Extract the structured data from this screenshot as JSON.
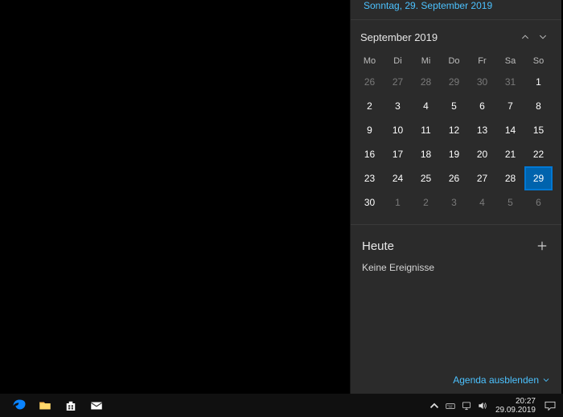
{
  "top_date": "Sonntag, 29. September 2019",
  "month_label": "September 2019",
  "days_of_week": [
    "Mo",
    "Di",
    "Mi",
    "Do",
    "Fr",
    "Sa",
    "So"
  ],
  "weeks": [
    [
      {
        "n": "26",
        "dim": true
      },
      {
        "n": "27",
        "dim": true
      },
      {
        "n": "28",
        "dim": true
      },
      {
        "n": "29",
        "dim": true
      },
      {
        "n": "30",
        "dim": true
      },
      {
        "n": "31",
        "dim": true
      },
      {
        "n": "1",
        "dim": false
      }
    ],
    [
      {
        "n": "2",
        "dim": false
      },
      {
        "n": "3",
        "dim": false
      },
      {
        "n": "4",
        "dim": false
      },
      {
        "n": "5",
        "dim": false
      },
      {
        "n": "6",
        "dim": false
      },
      {
        "n": "7",
        "dim": false
      },
      {
        "n": "8",
        "dim": false
      }
    ],
    [
      {
        "n": "9",
        "dim": false
      },
      {
        "n": "10",
        "dim": false
      },
      {
        "n": "11",
        "dim": false
      },
      {
        "n": "12",
        "dim": false
      },
      {
        "n": "13",
        "dim": false
      },
      {
        "n": "14",
        "dim": false
      },
      {
        "n": "15",
        "dim": false
      }
    ],
    [
      {
        "n": "16",
        "dim": false
      },
      {
        "n": "17",
        "dim": false
      },
      {
        "n": "18",
        "dim": false
      },
      {
        "n": "19",
        "dim": false
      },
      {
        "n": "20",
        "dim": false
      },
      {
        "n": "21",
        "dim": false
      },
      {
        "n": "22",
        "dim": false
      }
    ],
    [
      {
        "n": "23",
        "dim": false
      },
      {
        "n": "24",
        "dim": false
      },
      {
        "n": "25",
        "dim": false
      },
      {
        "n": "26",
        "dim": false
      },
      {
        "n": "27",
        "dim": false
      },
      {
        "n": "28",
        "dim": false
      },
      {
        "n": "29",
        "dim": false,
        "today": true
      }
    ],
    [
      {
        "n": "30",
        "dim": false
      },
      {
        "n": "1",
        "dim": true
      },
      {
        "n": "2",
        "dim": true
      },
      {
        "n": "3",
        "dim": true
      },
      {
        "n": "4",
        "dim": true
      },
      {
        "n": "5",
        "dim": true
      },
      {
        "n": "6",
        "dim": true
      }
    ]
  ],
  "agenda": {
    "title": "Heute",
    "no_events": "Keine Ereignisse",
    "hide_label": "Agenda ausblenden"
  },
  "clock": {
    "time": "20:27",
    "date": "29.09.2019"
  }
}
